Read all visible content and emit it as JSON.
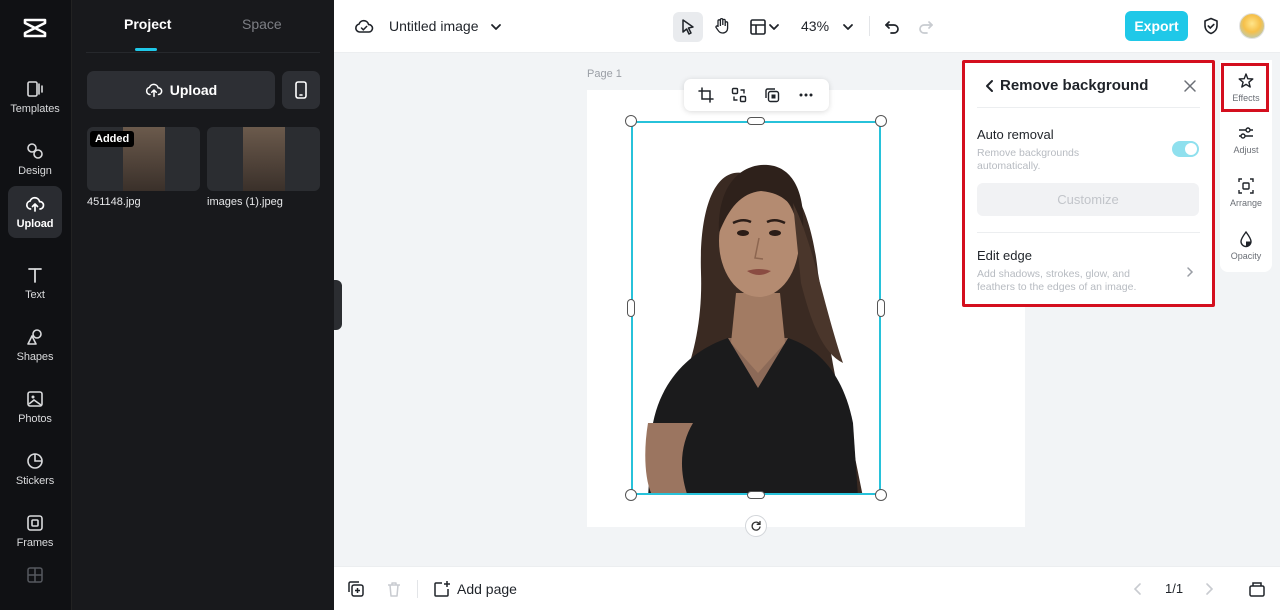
{
  "app": {
    "doc_title": "Untitled image",
    "zoom": "43%",
    "export_label": "Export"
  },
  "rail": {
    "items": [
      {
        "label": "Templates",
        "icon": "templates-icon"
      },
      {
        "label": "Design",
        "icon": "design-icon"
      },
      {
        "label": "Upload",
        "icon": "upload-cloud-icon",
        "active": true
      },
      {
        "label": "Text",
        "icon": "text-icon"
      },
      {
        "label": "Shapes",
        "icon": "shapes-icon"
      },
      {
        "label": "Photos",
        "icon": "photos-icon"
      },
      {
        "label": "Stickers",
        "icon": "stickers-icon"
      },
      {
        "label": "Frames",
        "icon": "frames-icon"
      }
    ]
  },
  "panel": {
    "tabs": [
      "Project",
      "Space"
    ],
    "upload_label": "Upload",
    "files": [
      {
        "name": "451148.jpg",
        "badge": "Added"
      },
      {
        "name": "images (1).jpeg",
        "badge": ""
      }
    ]
  },
  "canvas": {
    "page_label": "Page 1"
  },
  "remove_bg": {
    "title": "Remove background",
    "auto_title": "Auto removal",
    "auto_desc": "Remove backgrounds automatically.",
    "auto_enabled": true,
    "customize_label": "Customize",
    "edge_title": "Edit edge",
    "edge_desc": "Add shadows, strokes, glow, and feathers to the edges of an image."
  },
  "props": {
    "items": [
      "Effects",
      "Adjust",
      "Arrange",
      "Opacity"
    ]
  },
  "bottom": {
    "add_page_label": "Add page",
    "page_count": "1/1"
  },
  "colors": {
    "accent": "#1fc8e8",
    "highlight": "#d40f1e",
    "rail_bg": "#101114",
    "panel_bg": "#18191c"
  }
}
